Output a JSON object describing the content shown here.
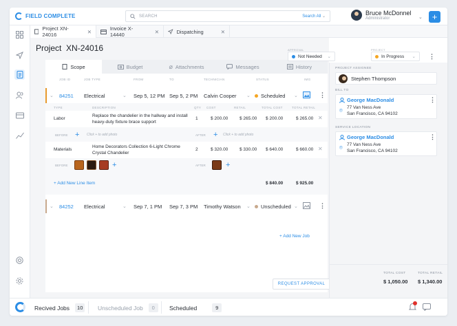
{
  "app": {
    "brand": "FIELD COMPLETE"
  },
  "search": {
    "placeholder": "SEARCH",
    "scope": "Search All"
  },
  "user": {
    "name": "Bruce McDonnel",
    "role": "Administrator"
  },
  "file_tabs": [
    {
      "label": "Project XN-24016"
    },
    {
      "label": "Invoice X-14440"
    },
    {
      "label": "Dispatching"
    }
  ],
  "project": {
    "label": "Project",
    "number": "XN-24016"
  },
  "status_selects": {
    "approval": {
      "label": "APPROVAL",
      "value": "Not Needed",
      "color": "#2b8de5"
    },
    "project": {
      "label": "PROJECT",
      "value": "In Progress",
      "color": "#f5a623"
    }
  },
  "content_tabs": [
    "Scope",
    "Budget",
    "Attachments",
    "Messages",
    "History"
  ],
  "jobs_header": [
    "JOB ID",
    "JOB TYPE",
    "FROM",
    "TO",
    "TECHNICIAN",
    "STATUS",
    "IMG"
  ],
  "line_header": [
    "TYPE",
    "DESCRIPTION",
    "QTY",
    "COST",
    "RETAIL",
    "TOTAL COST",
    "TOTAL RETAIL"
  ],
  "jobs": [
    {
      "id": "84251",
      "type": "Electrical",
      "from": "Sep 5, 12 PM",
      "to": "Sep 5, 2 PM",
      "technician": "Calvin Cooper",
      "status": "Scheduled",
      "status_color": "#f5a623",
      "lines": [
        {
          "type": "Labor",
          "description": "Replace the chandelier in the hallway and install heavy-duty fixture brace support",
          "qty": "1",
          "cost": "$ 200.00",
          "retail": "$ 265.00",
          "total_cost": "$ 200.00",
          "total_retail": "$ 265.00"
        },
        {
          "type": "Materials",
          "description": "Home Decorators Collection 6-Light Chrome Crystal Chandelier",
          "qty": "2",
          "cost": "$ 320.00",
          "retail": "$ 330.00",
          "total_cost": "$ 640.00",
          "total_retail": "$ 660.00"
        }
      ],
      "before_label": "BEFORE",
      "after_label": "AFTER",
      "photo_placeholder": "Click + to add photo",
      "add_line": "+ Add New Line Item",
      "sum_cost": "$ 840.00",
      "sum_retail": "$ 925.00"
    },
    {
      "id": "84252",
      "type": "Electrical",
      "from": "Sep 7, 1 PM",
      "to": "Sep 7, 3 PM",
      "technician": "Timothy Watson",
      "status": "Unscheduled",
      "status_color": "#c8a98d"
    }
  ],
  "add_job": "+ Add New Job",
  "request_approval": "REQUEST APPROVAL",
  "right_panel": {
    "assignee_label": "PROJECT ASSIGNEE",
    "assignee": "Stephen Thompson",
    "bill_label": "BILL TO",
    "bill_name": "George MacDonald",
    "bill_addr1": "77 Van Ness Ave",
    "bill_addr2": "San Francisco, CA 94102",
    "service_label": "SERVICE LOCATION",
    "service_name": "George MacDonald",
    "service_addr1": "77 Van Ness Ave",
    "service_addr2": "San Francisco, CA 94102",
    "total_cost_label": "TOTAL COST",
    "total_cost": "$ 1,050.00",
    "total_retail_label": "TOTAL RETAIL",
    "total_retail": "$ 1,340.00"
  },
  "statusbar": {
    "received": {
      "label": "Recived Jobs",
      "count": "10"
    },
    "unscheduled": {
      "label": "Unscheduled Job",
      "count": "0"
    },
    "scheduled": {
      "label": "Scheduled",
      "count": "9"
    }
  },
  "colors": {
    "accent": "#2b8de5",
    "notification": "#e0312b"
  }
}
